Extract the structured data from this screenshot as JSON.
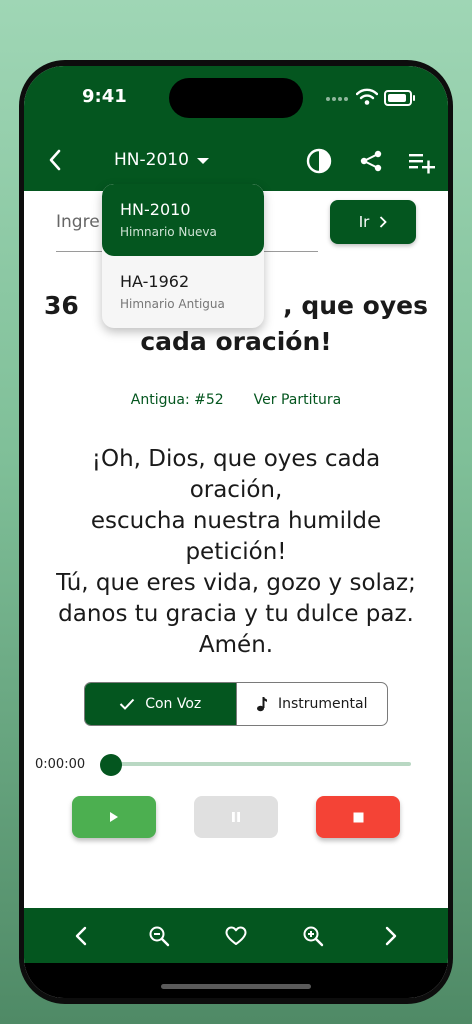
{
  "status_bar": {
    "time": "9:41"
  },
  "header": {
    "title": "HN-2010",
    "icons": [
      "back-arrow-icon",
      "contrast-icon",
      "share-icon",
      "playlist-add-icon"
    ]
  },
  "dropdown": {
    "items": [
      {
        "code": "HN-2010",
        "name": "Himnario Nueva",
        "selected": true
      },
      {
        "code": "HA-1962",
        "name": "Himnario Antigua",
        "selected": false
      }
    ]
  },
  "search": {
    "label_visible": "Ingre",
    "button_label": "Ir"
  },
  "hymn": {
    "title_line1_left": "36",
    "title_line1_right": ", que oyes",
    "title_line2": "cada oración!",
    "antigua_ref": "Antigua: #52",
    "score_link": "Ver Partitura",
    "lyrics": "¡Oh, Dios, que oyes cada\noración,\nescucha nuestra humilde\npetición!\nTú, que eres vida, gozo y solaz;\ndanos tu gracia y tu dulce paz.\nAmén."
  },
  "audio": {
    "mode_options": [
      "Con Voz",
      "Instrumental"
    ],
    "selected_mode": "Con Voz",
    "current_time": "0:00:00",
    "progress": 0,
    "controls": [
      "play-icon",
      "pause-icon",
      "stop-icon"
    ]
  },
  "bottom_nav": {
    "icons": [
      "chevron-left-icon",
      "zoom-out-icon",
      "heart-icon",
      "zoom-in-icon",
      "chevron-right-icon"
    ]
  },
  "colors": {
    "primary": "#04561f",
    "play": "#4caf50",
    "pause": "#e0e0e0",
    "stop": "#f44336"
  }
}
